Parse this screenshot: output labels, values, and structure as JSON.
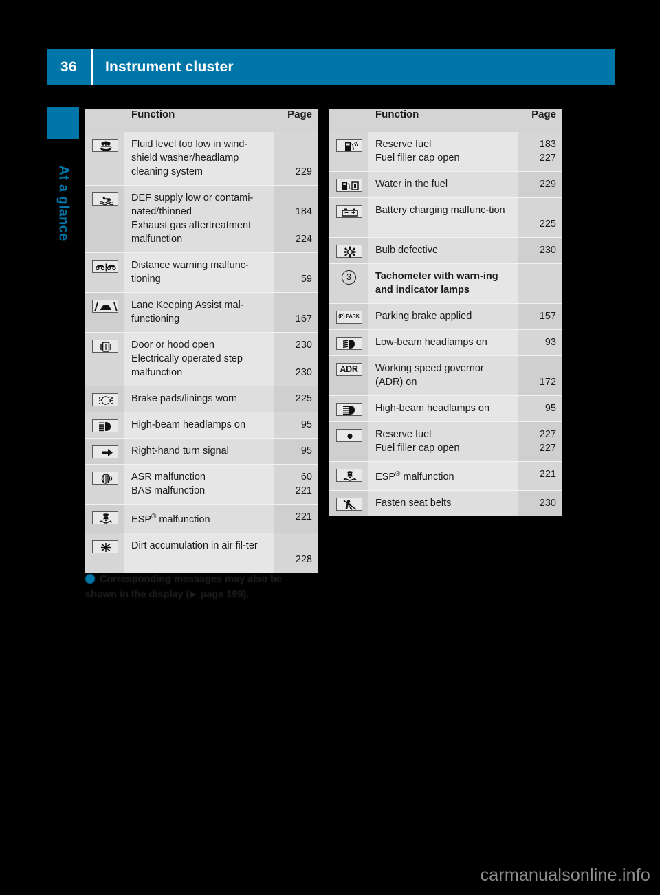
{
  "header": {
    "page_number": "36",
    "title": "Instrument cluster",
    "accent_color": "#0076a8"
  },
  "sidebar": {
    "label": "At a glance"
  },
  "columns": [
    {
      "id": "left",
      "head": {
        "function": "Function",
        "page": "Page"
      },
      "rows": [
        {
          "icon": "washer-fluid-icon",
          "entries": [
            {
              "text": "Fluid level too low in wind-shield washer/headlamp cleaning system",
              "page": "229"
            }
          ]
        },
        {
          "icon": "def-fluid-icon",
          "entries": [
            {
              "text": "DEF supply low or contami-nated/thinned",
              "page": "184"
            },
            {
              "text": "Exhaust gas aftertreatment malfunction",
              "page": "224"
            }
          ]
        },
        {
          "icon": "distance-warning-icon",
          "entries": [
            {
              "text": "Distance warning malfunc-tioning",
              "page": "59"
            }
          ]
        },
        {
          "icon": "lane-keeping-assist-icon",
          "entries": [
            {
              "text": "Lane Keeping Assist mal-functioning",
              "page": "167"
            }
          ]
        },
        {
          "icon": "door-hood-open-icon",
          "entries": [
            {
              "text": "Door or hood open",
              "page": "230"
            },
            {
              "text": "Electrically operated step malfunction",
              "page": "230"
            }
          ]
        },
        {
          "icon": "brake-pad-wear-icon",
          "entries": [
            {
              "text": "Brake pads/linings worn",
              "page": "225"
            }
          ]
        },
        {
          "icon": "high-beam-icon",
          "entries": [
            {
              "text": "High-beam headlamps on",
              "page": "95"
            }
          ]
        },
        {
          "icon": "right-turn-signal-icon",
          "entries": [
            {
              "text": "Right-hand turn signal",
              "page": "95"
            }
          ]
        },
        {
          "icon": "asr-icon",
          "entries": [
            {
              "text": "ASR malfunction",
              "page": "60"
            },
            {
              "text": "BAS malfunction",
              "page": "221"
            }
          ]
        },
        {
          "icon": "esp-icon",
          "entries": [
            {
              "text": "ESP® malfunction",
              "page": "221"
            }
          ]
        },
        {
          "icon": "air-filter-icon",
          "entries": [
            {
              "text": "Dirt accumulation in air fil-ter",
              "page": "228"
            }
          ]
        }
      ]
    },
    {
      "id": "right",
      "head": {
        "function": "Function",
        "page": "Page"
      },
      "rows": [
        {
          "icon": "reserve-fuel-pump-icon",
          "entries": [
            {
              "text": "Reserve fuel",
              "page": "183"
            },
            {
              "text": "Fuel filler cap open",
              "page": "227"
            }
          ]
        },
        {
          "icon": "water-in-fuel-icon",
          "entries": [
            {
              "text": "Water in the fuel",
              "page": "229"
            }
          ]
        },
        {
          "icon": "battery-charging-icon",
          "entries": [
            {
              "text": "Battery charging malfunc-tion",
              "page": "225"
            }
          ]
        },
        {
          "icon": "bulb-defective-icon",
          "entries": [
            {
              "text": "Bulb defective",
              "page": "230"
            }
          ]
        },
        {
          "icon": "callout-3-icon",
          "bold": true,
          "entries": [
            {
              "text": "Tachometer with warn-ing and indicator lamps",
              "page": ""
            }
          ]
        },
        {
          "icon": "parking-brake-icon",
          "entries": [
            {
              "text": "Parking brake applied",
              "page": "157"
            }
          ]
        },
        {
          "icon": "low-beam-icon",
          "entries": [
            {
              "text": "Low-beam headlamps on",
              "page": "93"
            }
          ]
        },
        {
          "icon": "adr-icon",
          "entries": [
            {
              "text": "Working speed governor (ADR) on",
              "page": "172"
            }
          ]
        },
        {
          "icon": "high-beam-icon",
          "entries": [
            {
              "text": "High-beam headlamps on",
              "page": "95"
            }
          ]
        },
        {
          "icon": "reserve-fuel-dot-icon",
          "entries": [
            {
              "text": "Reserve fuel",
              "page": "227"
            },
            {
              "text": "Fuel filler cap open",
              "page": "227"
            }
          ]
        },
        {
          "icon": "esp-icon",
          "entries": [
            {
              "text": "ESP® malfunction",
              "page": "221"
            }
          ]
        },
        {
          "icon": "seat-belt-icon",
          "entries": [
            {
              "text": "Fasten seat belts",
              "page": "230"
            }
          ]
        }
      ]
    }
  ],
  "note": {
    "part1": "Corresponding messages may also be shown in the display (",
    "part2": " page 199)."
  },
  "watermark": "carmanualsonline.info"
}
